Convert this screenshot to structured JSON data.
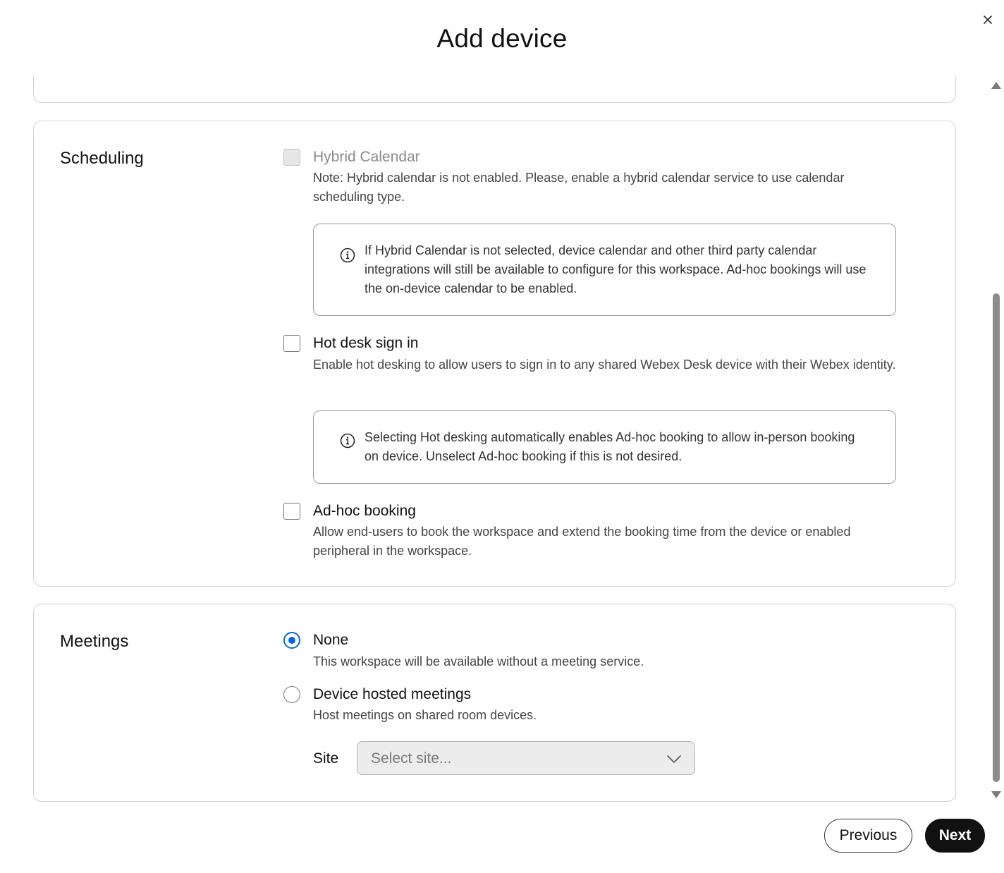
{
  "modal": {
    "title": "Add device"
  },
  "scheduling": {
    "title": "Scheduling",
    "hybrid_calendar": {
      "label": "Hybrid Calendar",
      "checked": false,
      "disabled": true,
      "note": "Note: Hybrid calendar is not enabled. Please, enable a hybrid calendar service to use calendar scheduling type.",
      "info": "If Hybrid Calendar is not selected, device calendar and other third party calendar integrations will still be available to configure for this workspace. Ad-hoc bookings will use the on-device calendar to be enabled."
    },
    "hot_desk": {
      "label": "Hot desk sign in",
      "checked": false,
      "description": "Enable hot desking to allow users to sign in to any shared Webex Desk device with their Webex identity.",
      "info": "Selecting Hot desking automatically enables Ad-hoc booking to allow in-person booking on device. Unselect Ad-hoc booking if this is not desired."
    },
    "adhoc": {
      "label": "Ad-hoc booking",
      "checked": false,
      "description": "Allow end-users to book the workspace and extend the booking time from the device or enabled peripheral in the workspace."
    }
  },
  "meetings": {
    "title": "Meetings",
    "none": {
      "label": "None",
      "selected": true,
      "description": "This workspace will be available without a meeting service."
    },
    "device_hosted": {
      "label": "Device hosted meetings",
      "selected": false,
      "description": "Host meetings on shared room devices."
    },
    "site": {
      "label": "Site",
      "placeholder": "Select site..."
    }
  },
  "footer": {
    "previous_label": "Previous",
    "next_label": "Next"
  },
  "colors": {
    "accent": "#0a66d6",
    "primary_button": "#111111"
  }
}
